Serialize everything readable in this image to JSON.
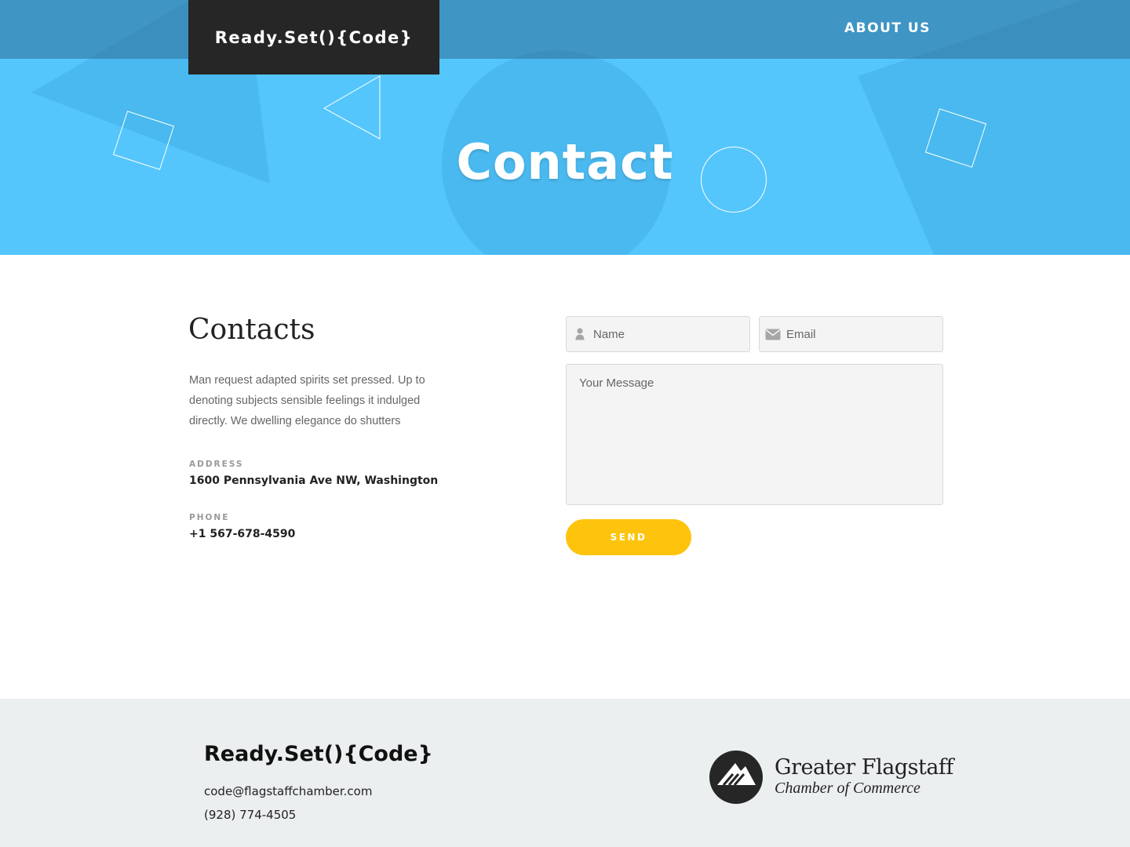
{
  "header": {
    "logo": "Ready.Set(){Code}",
    "nav": {
      "about_label": "ABOUT US"
    },
    "page_title": "Contact"
  },
  "contacts": {
    "heading": "Contacts",
    "description": "Man request adapted spirits set pressed. Up to denoting subjects sensible feelings it indulged directly. We dwelling elegance do shutters",
    "address_label": "ADDRESS",
    "address_value": "1600 Pennsylvania Ave NW, Washington",
    "phone_label": "PHONE",
    "phone_value": "+1 567-678-4590"
  },
  "form": {
    "name_placeholder": "Name",
    "email_placeholder": "Email",
    "message_placeholder": "Your Message",
    "send_label": "SEND",
    "icons": {
      "name": "user-icon",
      "email": "envelope-icon"
    }
  },
  "footer": {
    "logo": "Ready.Set(){Code}",
    "email": "code@flagstaffchamber.com",
    "phone": "(928) 774-4505",
    "chamber_title": "Greater Flagstaff",
    "chamber_subtitle": "Chamber of Commerce",
    "chamber_icon": "mountain-logo-icon"
  },
  "colors": {
    "hero_bg": "#54c6fc",
    "topbar": "#4596bf",
    "logo_box": "#262626",
    "send_button": "#fec40d",
    "footer_bg": "#ebeff0"
  }
}
